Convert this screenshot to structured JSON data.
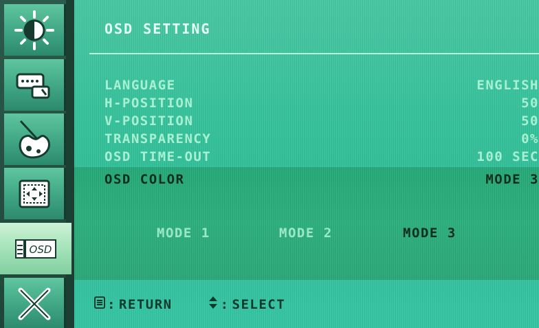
{
  "osd": {
    "title": "OSD SETTING",
    "items": [
      {
        "label": "LANGUAGE",
        "value": "ENGLISH"
      },
      {
        "label": "H-POSITION",
        "value": "50"
      },
      {
        "label": "V-POSITION",
        "value": "50"
      },
      {
        "label": "TRANSPARENCY",
        "value": "0%"
      },
      {
        "label": "OSD TIME-OUT",
        "value": "100 SEC"
      }
    ],
    "color": {
      "label": "OSD COLOR",
      "value": "MODE 3"
    },
    "modes": [
      "MODE 1",
      "MODE 2",
      "MODE 3"
    ],
    "selected_mode": "MODE 3"
  },
  "sidebar": {
    "tabs": [
      {
        "icon": "brightness-icon"
      },
      {
        "icon": "input-source-icon"
      },
      {
        "icon": "color-palette-icon"
      },
      {
        "icon": "image-position-icon"
      },
      {
        "icon": "osd-icon",
        "label": "OSD",
        "active": true
      },
      {
        "icon": "tools-icon"
      }
    ]
  },
  "footer": {
    "return_label": "RETURN",
    "select_label": "SELECT",
    "separator": ":"
  },
  "colors": {
    "panel": "#34c39c",
    "highlight_band": "#2bb07c",
    "text_light": "#a9f0d3",
    "text_dark": "#0f2e20",
    "active_tab": "#a5e3ba"
  }
}
